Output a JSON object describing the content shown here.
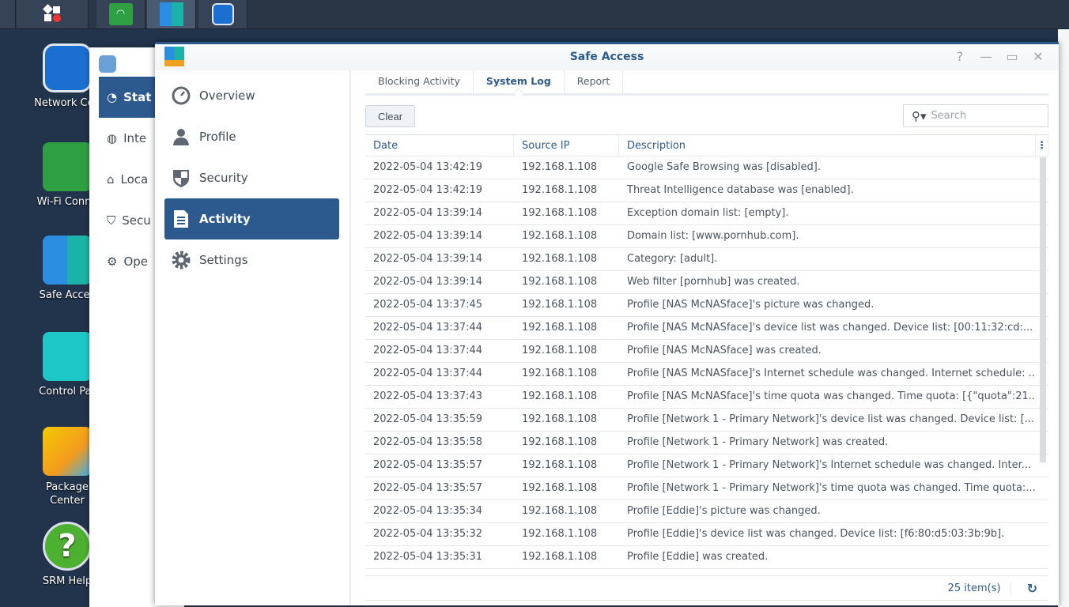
{
  "taskbar": {
    "items": [
      "main-menu",
      "wifi-connect",
      "safe-access",
      "network-center"
    ]
  },
  "desktop": {
    "icons": [
      {
        "label": "Network Cen"
      },
      {
        "label": "Wi-Fi Conne"
      },
      {
        "label": "Safe Acces"
      },
      {
        "label": "Control Par"
      },
      {
        "label": "Package Center"
      },
      {
        "label": "SRM Help"
      }
    ]
  },
  "back_window": {
    "items": [
      "Stat",
      "Inte",
      "Loca",
      "Secu",
      "Ope"
    ]
  },
  "window": {
    "title": "Safe Access",
    "controls": [
      "?",
      "—",
      "▭",
      "✕"
    ]
  },
  "sidebar": {
    "items": [
      {
        "label": "Overview",
        "icon": "gauge-icon"
      },
      {
        "label": "Profile",
        "icon": "user-icon"
      },
      {
        "label": "Security",
        "icon": "shield-icon"
      },
      {
        "label": "Activity",
        "icon": "document-icon",
        "selected": true
      },
      {
        "label": "Settings",
        "icon": "gear-icon"
      }
    ]
  },
  "tabs": [
    {
      "label": "Blocking Activity"
    },
    {
      "label": "System Log",
      "selected": true
    },
    {
      "label": "Report"
    }
  ],
  "toolbar": {
    "clear_label": "Clear",
    "search_placeholder": "Search"
  },
  "table": {
    "columns": [
      "Date",
      "Source IP",
      "Description"
    ],
    "rows": [
      [
        "2022-05-04 13:42:19",
        "192.168.1.108",
        "Google Safe Browsing was [disabled]."
      ],
      [
        "2022-05-04 13:42:19",
        "192.168.1.108",
        "Threat Intelligence database was [enabled]."
      ],
      [
        "2022-05-04 13:39:14",
        "192.168.1.108",
        "Exception domain list: [empty]."
      ],
      [
        "2022-05-04 13:39:14",
        "192.168.1.108",
        "Domain list: [www.pornhub.com]."
      ],
      [
        "2022-05-04 13:39:14",
        "192.168.1.108",
        "Category: [adult]."
      ],
      [
        "2022-05-04 13:39:14",
        "192.168.1.108",
        "Web filter [pornhub] was created."
      ],
      [
        "2022-05-04 13:37:45",
        "192.168.1.108",
        "Profile [NAS McNASface]'s picture was changed."
      ],
      [
        "2022-05-04 13:37:44",
        "192.168.1.108",
        "Profile [NAS McNASface]'s device list was changed. Device list: [00:11:32:cd:..."
      ],
      [
        "2022-05-04 13:37:44",
        "192.168.1.108",
        "Profile [NAS McNASface] was created."
      ],
      [
        "2022-05-04 13:37:44",
        "192.168.1.108",
        "Profile [NAS McNASface]'s Internet schedule was changed. Internet schedule: ..."
      ],
      [
        "2022-05-04 13:37:43",
        "192.168.1.108",
        "Profile [NAS McNASface]'s time quota was changed. Time quota: [{\"quota\":21..."
      ],
      [
        "2022-05-04 13:35:59",
        "192.168.1.108",
        "Profile [Network 1 - Primary Network]'s device list was changed. Device list: [..."
      ],
      [
        "2022-05-04 13:35:58",
        "192.168.1.108",
        "Profile [Network 1 - Primary Network] was created."
      ],
      [
        "2022-05-04 13:35:57",
        "192.168.1.108",
        "Profile [Network 1 - Primary Network]'s Internet schedule was changed. Inter..."
      ],
      [
        "2022-05-04 13:35:57",
        "192.168.1.108",
        "Profile [Network 1 - Primary Network]'s time quota was changed. Time quota:..."
      ],
      [
        "2022-05-04 13:35:34",
        "192.168.1.108",
        "Profile [Eddie]'s picture was changed."
      ],
      [
        "2022-05-04 13:35:32",
        "192.168.1.108",
        "Profile [Eddie]'s device list was changed. Device list: [f6:80:d5:03:3b:9b]."
      ],
      [
        "2022-05-04 13:35:31",
        "192.168.1.108",
        "Profile [Eddie] was created."
      ]
    ]
  },
  "footer": {
    "count": "25 item(s)"
  },
  "colors": {
    "accent": "#2d5a8e",
    "desktop": "#22344c"
  }
}
